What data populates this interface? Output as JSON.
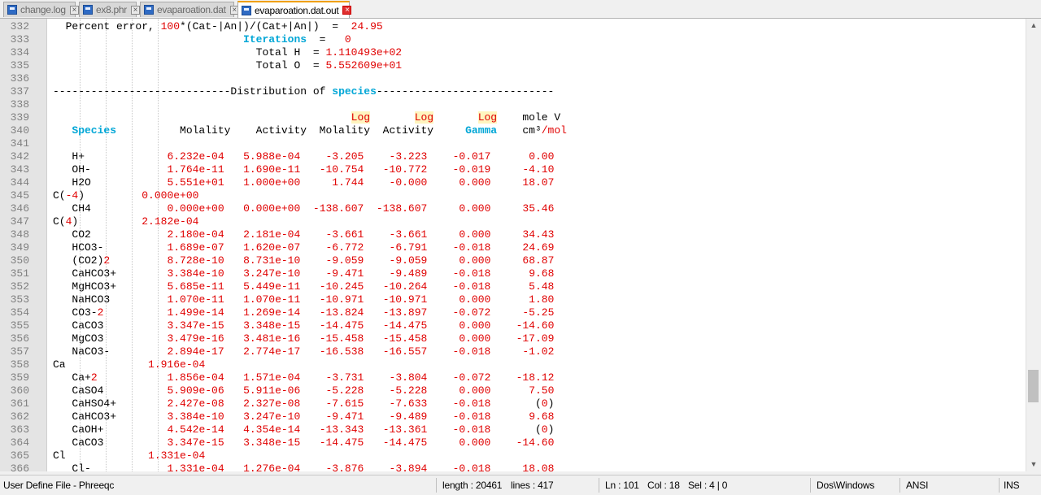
{
  "tabs": [
    {
      "label": "change.log",
      "active": false
    },
    {
      "label": "ex8.phr",
      "active": false
    },
    {
      "label": "evaparoation.dat",
      "active": false
    },
    {
      "label": "evaparoation.dat.out",
      "active": true
    }
  ],
  "colors": {
    "number": "#e00000",
    "keyword": "#00a6d6",
    "highlight": "#fff5bf",
    "line_number": "#808080"
  },
  "lines": [
    {
      "n": "332",
      "segs": [
        [
          "  Percent error, ",
          ""
        ],
        [
          "100",
          "red"
        ],
        [
          "*(Cat-|An|)/(Cat+|An|)  =  ",
          ""
        ],
        [
          "24.95",
          "red"
        ]
      ]
    },
    {
      "n": "333",
      "segs": [
        [
          "                              ",
          ""
        ],
        [
          "Iterations",
          "kw"
        ],
        [
          "  =   ",
          ""
        ],
        [
          "0",
          "red"
        ]
      ]
    },
    {
      "n": "334",
      "segs": [
        [
          "                                Total H  = ",
          ""
        ],
        [
          "1.110493e+02",
          "red"
        ]
      ]
    },
    {
      "n": "335",
      "segs": [
        [
          "                                Total O  = ",
          ""
        ],
        [
          "5.552609e+01",
          "red"
        ]
      ]
    },
    {
      "n": "336",
      "segs": []
    },
    {
      "n": "337",
      "segs": [
        [
          "----------------------------Distribution of ",
          ""
        ],
        [
          "species",
          "kw"
        ],
        [
          "----------------------------",
          ""
        ]
      ]
    },
    {
      "n": "338",
      "segs": []
    },
    {
      "n": "339",
      "segs": [
        [
          "                                               ",
          ""
        ],
        [
          "Log",
          "hl"
        ],
        [
          "       ",
          ""
        ],
        [
          "Log",
          "hl"
        ],
        [
          "       ",
          ""
        ],
        [
          "Log",
          "hl"
        ],
        [
          "    mole V",
          ""
        ]
      ]
    },
    {
      "n": "340",
      "segs": [
        [
          "   ",
          ""
        ],
        [
          "Species",
          "kw"
        ],
        [
          "          Molality    Activity  Molality  Activity     ",
          ""
        ],
        [
          "Gamma",
          "kw"
        ],
        [
          "    cm³",
          ""
        ],
        [
          "/mol",
          "red"
        ]
      ]
    },
    {
      "n": "341",
      "segs": []
    },
    {
      "n": "342",
      "segs": [
        [
          "   H+             ",
          ""
        ],
        [
          "6.232e-04",
          "red"
        ],
        [
          "   ",
          ""
        ],
        [
          "5.988e-04",
          "red"
        ],
        [
          "    ",
          ""
        ],
        [
          "-3.205",
          "red"
        ],
        [
          "    ",
          ""
        ],
        [
          "-3.223",
          "red"
        ],
        [
          "    ",
          ""
        ],
        [
          "-0.017",
          "red"
        ],
        [
          "      ",
          ""
        ],
        [
          "0.00",
          "red"
        ]
      ]
    },
    {
      "n": "343",
      "segs": [
        [
          "   OH-            ",
          ""
        ],
        [
          "1.764e-11",
          "red"
        ],
        [
          "   ",
          ""
        ],
        [
          "1.690e-11",
          "red"
        ],
        [
          "   ",
          ""
        ],
        [
          "-10.754",
          "red"
        ],
        [
          "   ",
          ""
        ],
        [
          "-10.772",
          "red"
        ],
        [
          "    ",
          ""
        ],
        [
          "-0.019",
          "red"
        ],
        [
          "     ",
          ""
        ],
        [
          "-4.10",
          "red"
        ]
      ]
    },
    {
      "n": "344",
      "segs": [
        [
          "   H2O            ",
          ""
        ],
        [
          "5.551e+01",
          "red"
        ],
        [
          "   ",
          ""
        ],
        [
          "1.000e+00",
          "red"
        ],
        [
          "     ",
          ""
        ],
        [
          "1.744",
          "red"
        ],
        [
          "    ",
          ""
        ],
        [
          "-0.000",
          "red"
        ],
        [
          "     ",
          ""
        ],
        [
          "0.000",
          "red"
        ],
        [
          "     ",
          ""
        ],
        [
          "18.07",
          "red"
        ]
      ]
    },
    {
      "n": "345",
      "segs": [
        [
          "C(",
          ""
        ],
        [
          "-4",
          "red"
        ],
        [
          ")         ",
          ""
        ],
        [
          "0.000e+00",
          "red"
        ]
      ]
    },
    {
      "n": "346",
      "segs": [
        [
          "   CH4            ",
          ""
        ],
        [
          "0.000e+00",
          "red"
        ],
        [
          "   ",
          ""
        ],
        [
          "0.000e+00",
          "red"
        ],
        [
          "  ",
          ""
        ],
        [
          "-138.607",
          "red"
        ],
        [
          "  ",
          ""
        ],
        [
          "-138.607",
          "red"
        ],
        [
          "     ",
          ""
        ],
        [
          "0.000",
          "red"
        ],
        [
          "     ",
          ""
        ],
        [
          "35.46",
          "red"
        ]
      ]
    },
    {
      "n": "347",
      "segs": [
        [
          "C(",
          ""
        ],
        [
          "4",
          "red"
        ],
        [
          ")          ",
          ""
        ],
        [
          "2.182e-04",
          "red"
        ]
      ]
    },
    {
      "n": "348",
      "segs": [
        [
          "   CO2            ",
          ""
        ],
        [
          "2.180e-04",
          "red"
        ],
        [
          "   ",
          ""
        ],
        [
          "2.181e-04",
          "red"
        ],
        [
          "    ",
          ""
        ],
        [
          "-3.661",
          "red"
        ],
        [
          "    ",
          ""
        ],
        [
          "-3.661",
          "red"
        ],
        [
          "     ",
          ""
        ],
        [
          "0.000",
          "red"
        ],
        [
          "     ",
          ""
        ],
        [
          "34.43",
          "red"
        ]
      ]
    },
    {
      "n": "349",
      "segs": [
        [
          "   HCO3-          ",
          ""
        ],
        [
          "1.689e-07",
          "red"
        ],
        [
          "   ",
          ""
        ],
        [
          "1.620e-07",
          "red"
        ],
        [
          "    ",
          ""
        ],
        [
          "-6.772",
          "red"
        ],
        [
          "    ",
          ""
        ],
        [
          "-6.791",
          "red"
        ],
        [
          "    ",
          ""
        ],
        [
          "-0.018",
          "red"
        ],
        [
          "     ",
          ""
        ],
        [
          "24.69",
          "red"
        ]
      ]
    },
    {
      "n": "350",
      "segs": [
        [
          "   (CO2)",
          ""
        ],
        [
          "2",
          "red"
        ],
        [
          "         ",
          ""
        ],
        [
          "8.728e-10",
          "red"
        ],
        [
          "   ",
          ""
        ],
        [
          "8.731e-10",
          "red"
        ],
        [
          "    ",
          ""
        ],
        [
          "-9.059",
          "red"
        ],
        [
          "    ",
          ""
        ],
        [
          "-9.059",
          "red"
        ],
        [
          "     ",
          ""
        ],
        [
          "0.000",
          "red"
        ],
        [
          "     ",
          ""
        ],
        [
          "68.87",
          "red"
        ]
      ]
    },
    {
      "n": "351",
      "segs": [
        [
          "   CaHCO3+        ",
          ""
        ],
        [
          "3.384e-10",
          "red"
        ],
        [
          "   ",
          ""
        ],
        [
          "3.247e-10",
          "red"
        ],
        [
          "    ",
          ""
        ],
        [
          "-9.471",
          "red"
        ],
        [
          "    ",
          ""
        ],
        [
          "-9.489",
          "red"
        ],
        [
          "    ",
          ""
        ],
        [
          "-0.018",
          "red"
        ],
        [
          "      ",
          ""
        ],
        [
          "9.68",
          "red"
        ]
      ]
    },
    {
      "n": "352",
      "segs": [
        [
          "   MgHCO3+        ",
          ""
        ],
        [
          "5.685e-11",
          "red"
        ],
        [
          "   ",
          ""
        ],
        [
          "5.449e-11",
          "red"
        ],
        [
          "   ",
          ""
        ],
        [
          "-10.245",
          "red"
        ],
        [
          "   ",
          ""
        ],
        [
          "-10.264",
          "red"
        ],
        [
          "    ",
          ""
        ],
        [
          "-0.018",
          "red"
        ],
        [
          "      ",
          ""
        ],
        [
          "5.48",
          "red"
        ]
      ]
    },
    {
      "n": "353",
      "segs": [
        [
          "   NaHCO3         ",
          ""
        ],
        [
          "1.070e-11",
          "red"
        ],
        [
          "   ",
          ""
        ],
        [
          "1.070e-11",
          "red"
        ],
        [
          "   ",
          ""
        ],
        [
          "-10.971",
          "red"
        ],
        [
          "   ",
          ""
        ],
        [
          "-10.971",
          "red"
        ],
        [
          "     ",
          ""
        ],
        [
          "0.000",
          "red"
        ],
        [
          "      ",
          ""
        ],
        [
          "1.80",
          "red"
        ]
      ]
    },
    {
      "n": "354",
      "segs": [
        [
          "   CO3-",
          ""
        ],
        [
          "2",
          "red"
        ],
        [
          "          ",
          ""
        ],
        [
          "1.499e-14",
          "red"
        ],
        [
          "   ",
          ""
        ],
        [
          "1.269e-14",
          "red"
        ],
        [
          "   ",
          ""
        ],
        [
          "-13.824",
          "red"
        ],
        [
          "   ",
          ""
        ],
        [
          "-13.897",
          "red"
        ],
        [
          "    ",
          ""
        ],
        [
          "-0.072",
          "red"
        ],
        [
          "     ",
          ""
        ],
        [
          "-5.25",
          "red"
        ]
      ]
    },
    {
      "n": "355",
      "segs": [
        [
          "   CaCO3          ",
          ""
        ],
        [
          "3.347e-15",
          "red"
        ],
        [
          "   ",
          ""
        ],
        [
          "3.348e-15",
          "red"
        ],
        [
          "   ",
          ""
        ],
        [
          "-14.475",
          "red"
        ],
        [
          "   ",
          ""
        ],
        [
          "-14.475",
          "red"
        ],
        [
          "     ",
          ""
        ],
        [
          "0.000",
          "red"
        ],
        [
          "    ",
          ""
        ],
        [
          "-14.60",
          "red"
        ]
      ]
    },
    {
      "n": "356",
      "segs": [
        [
          "   MgCO3          ",
          ""
        ],
        [
          "3.479e-16",
          "red"
        ],
        [
          "   ",
          ""
        ],
        [
          "3.481e-16",
          "red"
        ],
        [
          "   ",
          ""
        ],
        [
          "-15.458",
          "red"
        ],
        [
          "   ",
          ""
        ],
        [
          "-15.458",
          "red"
        ],
        [
          "     ",
          ""
        ],
        [
          "0.000",
          "red"
        ],
        [
          "    ",
          ""
        ],
        [
          "-17.09",
          "red"
        ]
      ]
    },
    {
      "n": "357",
      "segs": [
        [
          "   NaCO3-         ",
          ""
        ],
        [
          "2.894e-17",
          "red"
        ],
        [
          "   ",
          ""
        ],
        [
          "2.774e-17",
          "red"
        ],
        [
          "   ",
          ""
        ],
        [
          "-16.538",
          "red"
        ],
        [
          "   ",
          ""
        ],
        [
          "-16.557",
          "red"
        ],
        [
          "    ",
          ""
        ],
        [
          "-0.018",
          "red"
        ],
        [
          "     ",
          ""
        ],
        [
          "-1.02",
          "red"
        ]
      ]
    },
    {
      "n": "358",
      "segs": [
        [
          "Ca             ",
          ""
        ],
        [
          "1.916e-04",
          "red"
        ]
      ]
    },
    {
      "n": "359",
      "segs": [
        [
          "   Ca+",
          ""
        ],
        [
          "2",
          "red"
        ],
        [
          "           ",
          ""
        ],
        [
          "1.856e-04",
          "red"
        ],
        [
          "   ",
          ""
        ],
        [
          "1.571e-04",
          "red"
        ],
        [
          "    ",
          ""
        ],
        [
          "-3.731",
          "red"
        ],
        [
          "    ",
          ""
        ],
        [
          "-3.804",
          "red"
        ],
        [
          "    ",
          ""
        ],
        [
          "-0.072",
          "red"
        ],
        [
          "    ",
          ""
        ],
        [
          "-18.12",
          "red"
        ]
      ]
    },
    {
      "n": "360",
      "segs": [
        [
          "   CaSO4          ",
          ""
        ],
        [
          "5.909e-06",
          "red"
        ],
        [
          "   ",
          ""
        ],
        [
          "5.911e-06",
          "red"
        ],
        [
          "    ",
          ""
        ],
        [
          "-5.228",
          "red"
        ],
        [
          "    ",
          ""
        ],
        [
          "-5.228",
          "red"
        ],
        [
          "     ",
          ""
        ],
        [
          "0.000",
          "red"
        ],
        [
          "      ",
          ""
        ],
        [
          "7.50",
          "red"
        ]
      ]
    },
    {
      "n": "361",
      "segs": [
        [
          "   CaHSO4+        ",
          ""
        ],
        [
          "2.427e-08",
          "red"
        ],
        [
          "   ",
          ""
        ],
        [
          "2.327e-08",
          "red"
        ],
        [
          "    ",
          ""
        ],
        [
          "-7.615",
          "red"
        ],
        [
          "    ",
          ""
        ],
        [
          "-7.633",
          "red"
        ],
        [
          "    ",
          ""
        ],
        [
          "-0.018",
          "red"
        ],
        [
          "       (",
          ""
        ],
        [
          "0",
          "red"
        ],
        [
          ")",
          ""
        ]
      ]
    },
    {
      "n": "362",
      "segs": [
        [
          "   CaHCO3+        ",
          ""
        ],
        [
          "3.384e-10",
          "red"
        ],
        [
          "   ",
          ""
        ],
        [
          "3.247e-10",
          "red"
        ],
        [
          "    ",
          ""
        ],
        [
          "-9.471",
          "red"
        ],
        [
          "    ",
          ""
        ],
        [
          "-9.489",
          "red"
        ],
        [
          "    ",
          ""
        ],
        [
          "-0.018",
          "red"
        ],
        [
          "      ",
          ""
        ],
        [
          "9.68",
          "red"
        ]
      ]
    },
    {
      "n": "363",
      "segs": [
        [
          "   CaOH+          ",
          ""
        ],
        [
          "4.542e-14",
          "red"
        ],
        [
          "   ",
          ""
        ],
        [
          "4.354e-14",
          "red"
        ],
        [
          "   ",
          ""
        ],
        [
          "-13.343",
          "red"
        ],
        [
          "   ",
          ""
        ],
        [
          "-13.361",
          "red"
        ],
        [
          "    ",
          ""
        ],
        [
          "-0.018",
          "red"
        ],
        [
          "       (",
          ""
        ],
        [
          "0",
          "red"
        ],
        [
          ")",
          ""
        ]
      ]
    },
    {
      "n": "364",
      "segs": [
        [
          "   CaCO3          ",
          ""
        ],
        [
          "3.347e-15",
          "red"
        ],
        [
          "   ",
          ""
        ],
        [
          "3.348e-15",
          "red"
        ],
        [
          "   ",
          ""
        ],
        [
          "-14.475",
          "red"
        ],
        [
          "   ",
          ""
        ],
        [
          "-14.475",
          "red"
        ],
        [
          "     ",
          ""
        ],
        [
          "0.000",
          "red"
        ],
        [
          "    ",
          ""
        ],
        [
          "-14.60",
          "red"
        ]
      ]
    },
    {
      "n": "365",
      "segs": [
        [
          "Cl             ",
          ""
        ],
        [
          "1.331e-04",
          "red"
        ]
      ]
    },
    {
      "n": "366",
      "segs": [
        [
          "   Cl-            ",
          ""
        ],
        [
          "1.331e-04",
          "red"
        ],
        [
          "   ",
          ""
        ],
        [
          "1.276e-04",
          "red"
        ],
        [
          "    ",
          ""
        ],
        [
          "-3.876",
          "red"
        ],
        [
          "    ",
          ""
        ],
        [
          "-3.894",
          "red"
        ],
        [
          "    ",
          ""
        ],
        [
          "-0.018",
          "red"
        ],
        [
          "     ",
          ""
        ],
        [
          "18.08",
          "red"
        ]
      ]
    }
  ],
  "statusbar": {
    "language": "User Define File - Phreeqc",
    "length": "length : 20461",
    "lines": "lines : 417",
    "ln": "Ln : 101",
    "col": "Col : 18",
    "sel": "Sel : 4 | 0",
    "eol": "Dos\\Windows",
    "encoding": "ANSI",
    "mode": "INS"
  },
  "scroll": {
    "position_fraction": 0.79
  }
}
